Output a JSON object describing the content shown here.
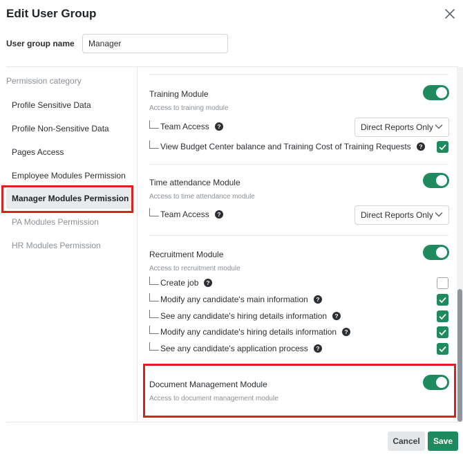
{
  "dialog": {
    "title": "Edit User Group",
    "name_label": "User group name",
    "name_value": "Manager"
  },
  "sidebar": {
    "heading": "Permission category",
    "items": [
      {
        "label": "Profile Sensitive Data",
        "state": "normal"
      },
      {
        "label": "Profile Non-Sensitive Data",
        "state": "normal"
      },
      {
        "label": "Pages Access",
        "state": "normal"
      },
      {
        "label": "Employee Modules Permission",
        "state": "normal"
      },
      {
        "label": "Manager Modules Permission",
        "state": "active"
      },
      {
        "label": "PA Modules Permission",
        "state": "muted"
      },
      {
        "label": "HR Modules Permission",
        "state": "muted"
      }
    ]
  },
  "modules": {
    "training": {
      "title": "Training Module",
      "desc": "Access to training module",
      "enabled": true,
      "team_access_label": "Team Access",
      "team_access_value": "Direct Reports Only",
      "budget_label": "View Budget Center balance and Training Cost of Training Requests",
      "budget_checked": true
    },
    "time_attendance": {
      "title": "Time attendance Module",
      "desc": "Access to time attendance module",
      "enabled": true,
      "team_access_label": "Team Access",
      "team_access_value": "Direct Reports Only"
    },
    "recruitment": {
      "title": "Recruitment Module",
      "desc": "Access to recruitment module",
      "enabled": true,
      "permissions": [
        {
          "label": "Create job",
          "checked": false
        },
        {
          "label": "Modify any candidate's main information",
          "checked": true
        },
        {
          "label": "See any candidate's hiring details information",
          "checked": true
        },
        {
          "label": "Modify any candidate's hiring details information",
          "checked": true
        },
        {
          "label": "See any candidate's application process",
          "checked": true
        }
      ]
    },
    "document_management": {
      "title": "Document Management Module",
      "desc": "Access to document management module",
      "enabled": true
    }
  },
  "footer": {
    "cancel_label": "Cancel",
    "save_label": "Save"
  },
  "colors": {
    "accent": "#1e8a5e",
    "highlight": "#d9221c"
  },
  "icons": {
    "close": "close-icon",
    "help": "question-circle-icon",
    "chevron": "chevron-down-icon",
    "check": "check-icon"
  }
}
